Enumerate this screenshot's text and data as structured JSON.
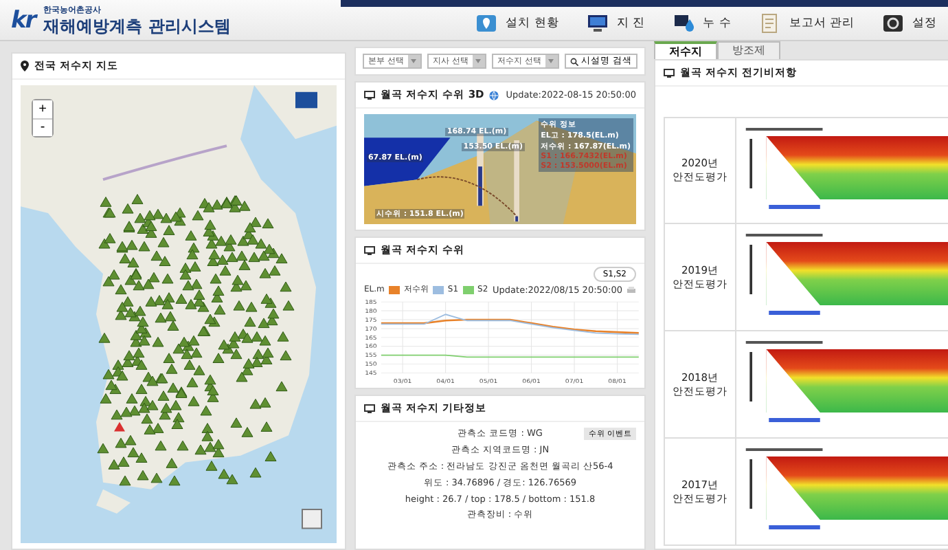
{
  "header": {
    "logo": "kr",
    "org": "한국농어촌공사",
    "title": "재해예방계측 관리시스템",
    "menu": [
      {
        "label": "설치 현황",
        "kind": "install"
      },
      {
        "label": "지 진",
        "kind": "monitor"
      },
      {
        "label": "누 수",
        "kind": "leak"
      },
      {
        "label": "보고서 관리",
        "kind": "report"
      },
      {
        "label": "설정",
        "kind": "settings"
      }
    ]
  },
  "tabs": [
    {
      "label": "저수지",
      "selected": true
    },
    {
      "label": "방조제",
      "selected": false
    }
  ],
  "map_panel": {
    "title": "전국 저수지 지도",
    "zoom_in": "+",
    "zoom_out": "-"
  },
  "filters": {
    "selects": [
      "본부 선택",
      "지사 선택",
      "저수지 선택"
    ],
    "search": "시설명 검색"
  },
  "scene_card": {
    "title": "월곡 저수지 수위 3D",
    "update": "Update:2022-08-15 20:50:00",
    "labels": [
      "168.74 EL.(m)",
      "153.50 EL.(m)",
      "67.87 EL.(m)",
      "시수위 : 151.8 EL.(m)"
    ],
    "info_title": "수위 정보",
    "info_lines": [
      {
        "text": "EL고 : 178.5(EL.m)",
        "color": "#ffffff"
      },
      {
        "text": "저수위 : 167.87(EL.m)",
        "color": "#ffffff"
      },
      {
        "text": "S1 : 166.7432(EL.m)",
        "color": "#c0392b"
      },
      {
        "text": "S2 : 153.5000(EL.m)",
        "color": "#c0392b"
      }
    ]
  },
  "level_card": {
    "title": "월곡 저수지 수위",
    "button": "S1,S2",
    "unit": "EL.m",
    "update": "Update:2022/08/15 20:50:00",
    "chart_data": {
      "type": "line",
      "grid": true,
      "categories": [
        null,
        "03/01",
        null,
        "04/01",
        null,
        "05/01",
        null,
        "06/01",
        null,
        "07/01",
        null,
        "08/01",
        null
      ],
      "yticks": [
        145,
        150,
        155,
        160,
        165,
        170,
        175,
        180,
        185
      ],
      "ylim": [
        145,
        185
      ],
      "series": [
        {
          "name": "저수위",
          "color": "#e8822a",
          "values": [
            173,
            173,
            173,
            174.5,
            175,
            175,
            175,
            173,
            171,
            169.5,
            168.5,
            168,
            167.5
          ]
        },
        {
          "name": "S1",
          "color": "#9dbde0",
          "values": [
            172.5,
            172.5,
            172.5,
            178,
            174.5,
            174.5,
            174.5,
            172.5,
            170.5,
            169,
            167.5,
            167,
            166.7
          ]
        },
        {
          "name": "S2",
          "color": "#7fcf6e",
          "values": [
            155,
            155,
            155,
            155,
            154,
            154,
            154,
            154,
            154,
            154,
            154,
            154,
            154
          ]
        }
      ]
    }
  },
  "info_card": {
    "title": "월곡 저수지 기타정보",
    "button": "수위 이벤트",
    "lines": [
      "관측소 코드명 : WG",
      "관측소 지역코드명 : JN",
      "관측소 주소 : 전라남도 강진군 옴천면 월곡리 산56-4",
      "위도 : 34.76896 / 경도: 126.76569",
      "height : 26.7 / top : 178.5 / bottom : 151.8",
      "관측장비 : 수위"
    ]
  },
  "resistivity": {
    "title": "월곡 저수지 전기비저항",
    "rows": [
      {
        "year": "2020년",
        "label": "안전도평가"
      },
      {
        "year": "2019년",
        "label": "안전도평가"
      },
      {
        "year": "2018년",
        "label": "안전도평가"
      },
      {
        "year": "2017년",
        "label": "안전도평가"
      }
    ]
  }
}
